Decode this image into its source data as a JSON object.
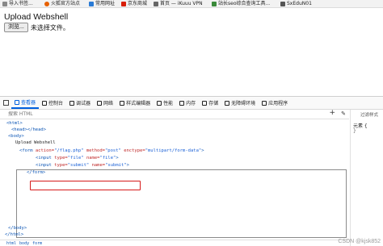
{
  "bookmarks": [
    {
      "label": "导入书签...",
      "icon": "import-icon",
      "color": "#888888"
    },
    {
      "label": "火狐官方站点",
      "icon": "firefox-icon",
      "color": "#e66000"
    },
    {
      "label": "常用网址",
      "icon": "folder-icon",
      "color": "#2a7bd6"
    },
    {
      "label": "京东商城",
      "icon": "jd-icon",
      "color": "#d81e06"
    },
    {
      "label": "首页 — iKuuu VPN",
      "icon": "page-icon",
      "color": "#666666"
    },
    {
      "label": "站长seo综合查询工具...",
      "icon": "seo-icon",
      "color": "#3a8a3a"
    },
    {
      "label": "SxEduN01",
      "icon": "page-icon",
      "color": "#555555"
    }
  ],
  "page": {
    "title": "Upload Webshell",
    "browse_label": "浏览...",
    "no_file_label": "未选择文件。"
  },
  "devtools": {
    "tabs": [
      {
        "label": "查看器",
        "icon": "inspector-icon",
        "active": true
      },
      {
        "label": "控制台",
        "icon": "console-icon",
        "active": false
      },
      {
        "label": "调试器",
        "icon": "debugger-icon",
        "active": false
      },
      {
        "label": "网络",
        "icon": "network-icon",
        "active": false
      },
      {
        "label": "样式编辑器",
        "icon": "style-editor-icon",
        "active": false
      },
      {
        "label": "性能",
        "icon": "performance-icon",
        "active": false
      },
      {
        "label": "内存",
        "icon": "memory-icon",
        "active": false
      },
      {
        "label": "存储",
        "icon": "storage-icon",
        "active": false
      },
      {
        "label": "无障碍环境",
        "icon": "accessibility-icon",
        "active": false
      },
      {
        "label": "应用程序",
        "icon": "application-icon",
        "active": false
      }
    ],
    "search_placeholder": "搜索 HTML",
    "side_filter_placeholder": "过滤样式",
    "side_label": "元素 {",
    "side_sub": "}",
    "tree": {
      "doctype": "<html>",
      "head": "<head></head>",
      "body_open": "<body>",
      "body_text": "Upload Webshell",
      "form_tag": "form",
      "form_action_attr": "action=",
      "form_action_val": "\"/flag.php\"",
      "form_method_attr": "method=",
      "form_method_val": "\"post\"",
      "form_enctype_attr": "enctype=",
      "form_enctype_val": "\"multipart/form-data\"",
      "input1_type_val": "\"file\"",
      "input1_name_val": "\"file\"",
      "input2_type_val": "\"submit\"",
      "input2_name_val": "\"submit\"",
      "input_tag": "input",
      "type_attr": "type=",
      "name_attr": "name=",
      "form_close": "</form>",
      "body_close": "</body>",
      "html_close": "</html>"
    },
    "breadcrumb": [
      "html",
      "body",
      "form"
    ]
  },
  "watermark": "CSDN @kjsk852"
}
